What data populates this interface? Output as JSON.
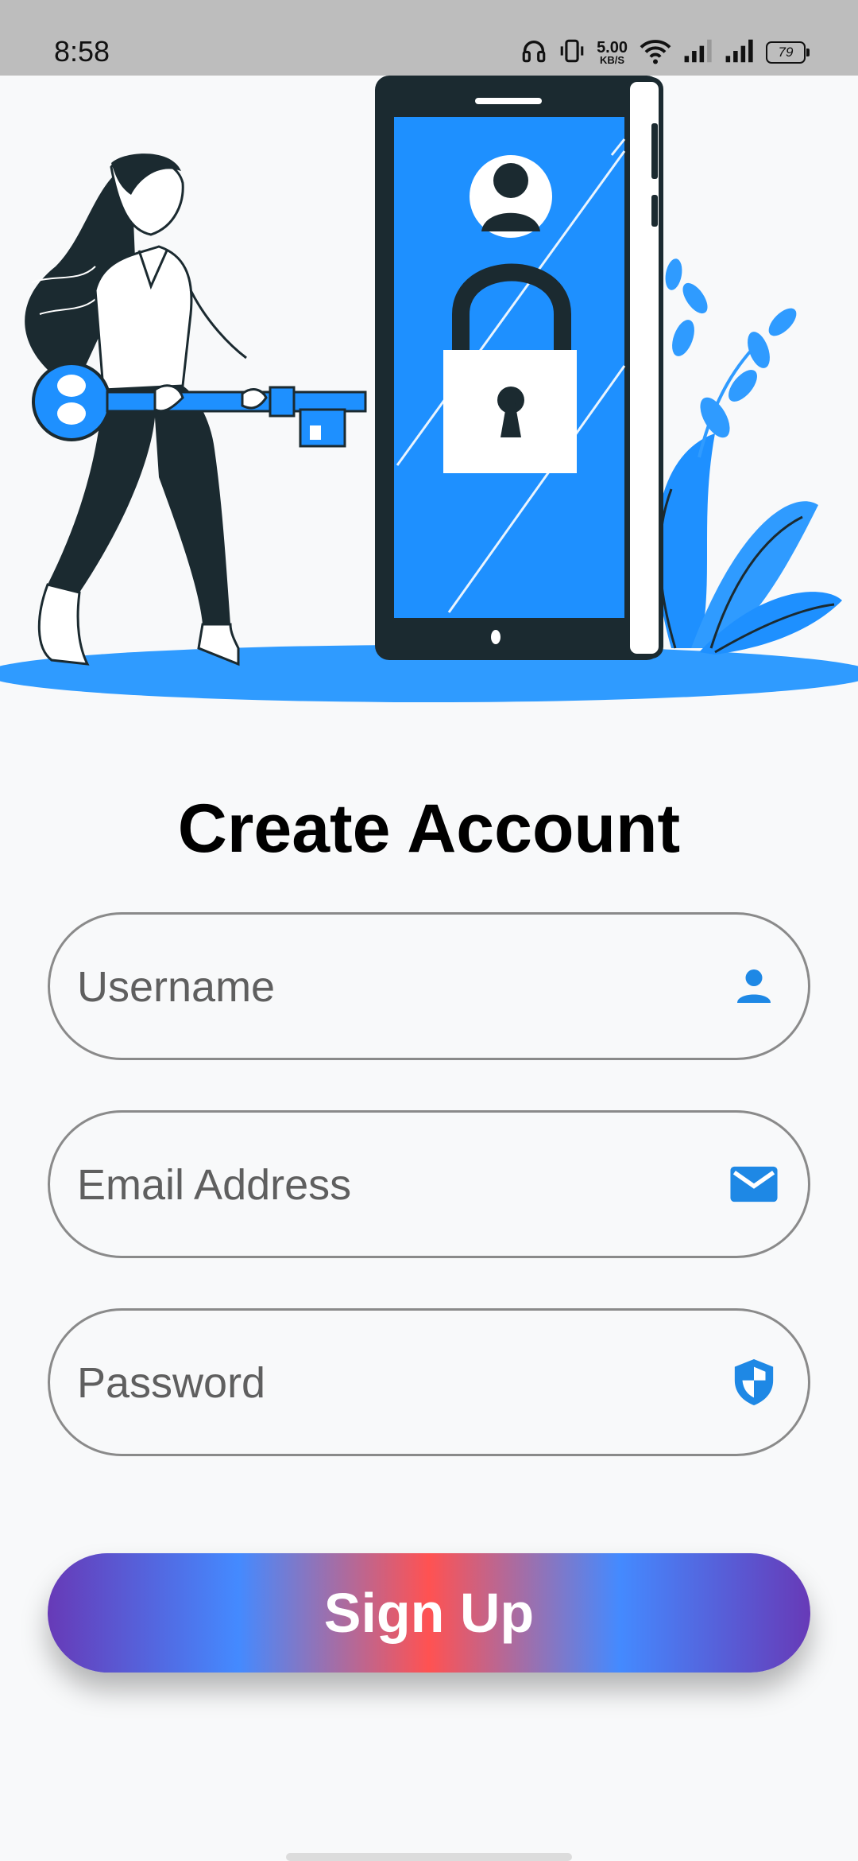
{
  "status_bar": {
    "time": "8:58",
    "net_speed_value": "5.00",
    "net_speed_unit": "KB/S",
    "battery_level": "79",
    "icons": [
      "headphones-icon",
      "vibrate-icon",
      "wifi-icon",
      "signal-icon",
      "signal-icon",
      "battery-icon"
    ]
  },
  "illustration": {
    "icons": [
      "woman-holding-key-illustration",
      "phone-icon",
      "user-avatar-icon",
      "padlock-icon",
      "plant-illustration"
    ],
    "accent_color": "#1e90ff"
  },
  "form": {
    "title": "Create Account",
    "username": {
      "placeholder": "Username",
      "value": "",
      "icon": "person-icon"
    },
    "email": {
      "placeholder": "Email Address",
      "value": "",
      "icon": "mail-icon"
    },
    "password": {
      "placeholder": "Password",
      "value": "",
      "icon": "shield-icon"
    },
    "signup_label": "Sign Up",
    "icon_color": "#1e88e5",
    "button_gradient": [
      "#673ab7",
      "#448aff",
      "#ff5252",
      "#448aff",
      "#673ab7"
    ]
  }
}
